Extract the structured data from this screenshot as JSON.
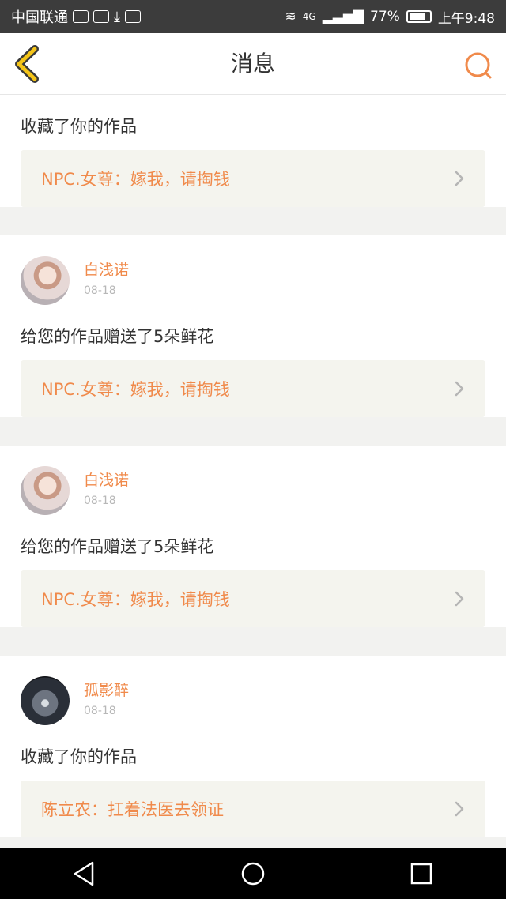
{
  "status_bar": {
    "carrier": "中国联通",
    "network": "4G",
    "battery": "77%",
    "time": "上午9:48"
  },
  "header": {
    "title": "消息"
  },
  "feed": [
    {
      "partial": true,
      "action": "收藏了你的作品",
      "work": "NPC.女尊：嫁我，请掏钱"
    },
    {
      "user": "白浅诺",
      "date": "08-18",
      "avatar": "girl",
      "action": "给您的作品赠送了5朵鲜花",
      "work": "NPC.女尊：嫁我，请掏钱"
    },
    {
      "user": "白浅诺",
      "date": "08-18",
      "avatar": "girl",
      "action": "给您的作品赠送了5朵鲜花",
      "work": "NPC.女尊：嫁我，请掏钱"
    },
    {
      "user": "孤影醉",
      "date": "08-18",
      "avatar": "tunnel",
      "action": "收藏了你的作品",
      "work": "陈立农：扛着法医去领证"
    }
  ],
  "colors": {
    "accent": "#f08a4b",
    "back_icon": "#f5c518"
  }
}
